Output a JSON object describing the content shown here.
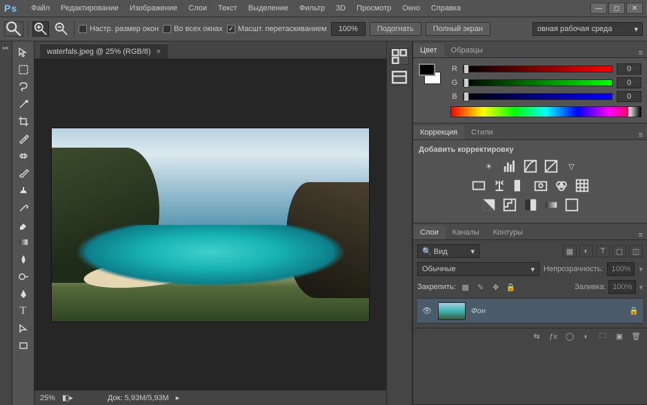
{
  "app": {
    "logo": "Ps"
  },
  "menu": [
    "Файл",
    "Редактирование",
    "Изображение",
    "Слои",
    "Текст",
    "Выделение",
    "Фильтр",
    "3D",
    "Просмотр",
    "Окно",
    "Справка"
  ],
  "options": {
    "resize_windows": "Настр. размер окон",
    "all_windows": "Во всех окнах",
    "scrubby_zoom": "Масшт. перетаскиванием",
    "zoom_value": "100%",
    "fit": "Подогнать",
    "fullscreen": "Полный экран",
    "workspace": "овная рабочая среда"
  },
  "document": {
    "tab_title": "waterfals.jpeg @ 25% (RGB/8)",
    "zoom": "25%",
    "doc_size": "Док: 5,93M/5,93M"
  },
  "panels": {
    "color": {
      "tab_color": "Цвет",
      "tab_swatches": "Образцы",
      "r_label": "R",
      "r_val": "0",
      "g_label": "G",
      "g_val": "0",
      "b_label": "B",
      "b_val": "0"
    },
    "adjustments": {
      "tab_adjust": "Коррекция",
      "tab_styles": "Стили",
      "add_label": "Добавить корректировку"
    },
    "layers": {
      "tab_layers": "Слои",
      "tab_channels": "Каналы",
      "tab_paths": "Контуры",
      "filter_kind": "Вид",
      "blend_mode": "Обычные",
      "opacity_label": "Непрозрачность:",
      "opacity_val": "100%",
      "lock_label": "Закрепить:",
      "fill_label": "Заливка:",
      "fill_val": "100%",
      "layer_name": "Фон"
    }
  }
}
